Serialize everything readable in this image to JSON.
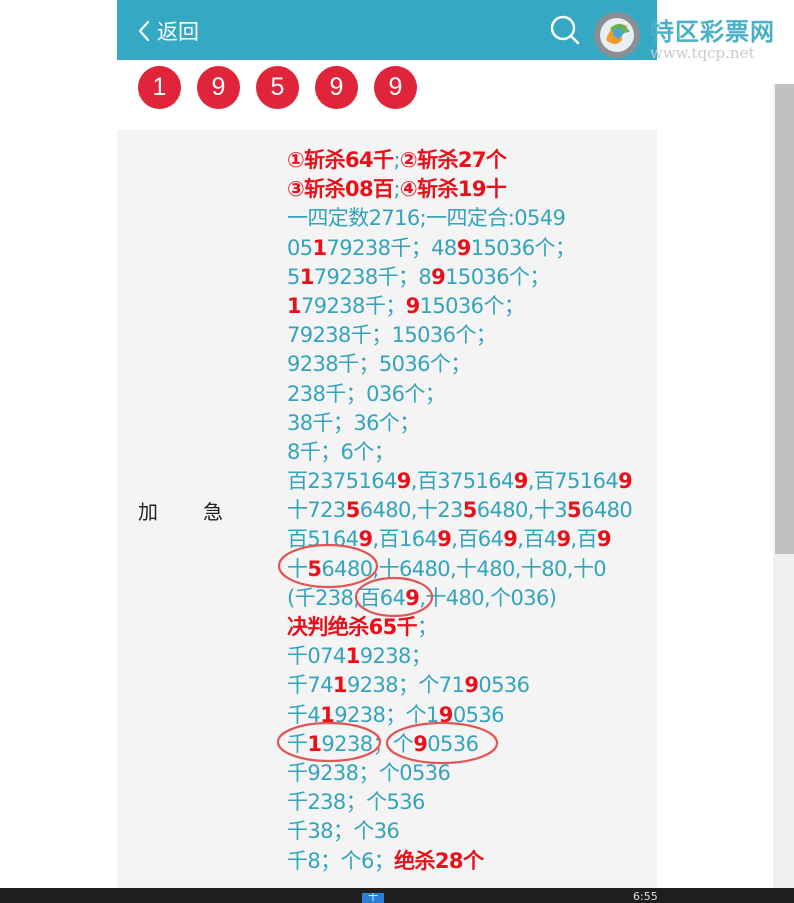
{
  "header": {
    "back_label": "返回",
    "logo_title": "特区彩票网",
    "logo_url": "www.tqcp.net"
  },
  "balls": [
    "1",
    "9",
    "5",
    "9",
    "9"
  ],
  "row_label": {
    "left": "加",
    "right": "急"
  },
  "lines": [
    [
      {
        "t": "①斩杀64千",
        "c": "r"
      },
      {
        "t": ";"
      },
      {
        "t": "②斩杀27个",
        "c": "r"
      }
    ],
    [
      {
        "t": "③斩杀08百",
        "c": "r"
      },
      {
        "t": ";"
      },
      {
        "t": "④斩杀19十",
        "c": "r"
      }
    ],
    [
      {
        "t": "一四定数2716;一四定合:0549"
      }
    ],
    [
      {
        "t": "05"
      },
      {
        "t": "1",
        "c": "b"
      },
      {
        "t": "79238千；48"
      },
      {
        "t": "9",
        "c": "b"
      },
      {
        "t": "15036个；"
      }
    ],
    [
      {
        "t": "5"
      },
      {
        "t": "1",
        "c": "b"
      },
      {
        "t": "79238千；8"
      },
      {
        "t": "9",
        "c": "b"
      },
      {
        "t": "15036个；"
      }
    ],
    [
      {
        "t": "1",
        "c": "b"
      },
      {
        "t": "79238千；"
      },
      {
        "t": "9",
        "c": "b"
      },
      {
        "t": "15036个；"
      }
    ],
    [
      {
        "t": "79238千；15036个；"
      }
    ],
    [
      {
        "t": "9238千；5036个；"
      }
    ],
    [
      {
        "t": "238千；036个；"
      }
    ],
    [
      {
        "t": "38千；36个；"
      }
    ],
    [
      {
        "t": "8千；6个；"
      }
    ],
    [
      {
        "t": "百2375164"
      },
      {
        "t": "9",
        "c": "b"
      },
      {
        "t": ",百375164"
      },
      {
        "t": "9",
        "c": "b"
      },
      {
        "t": ",百75164"
      },
      {
        "t": "9",
        "c": "b"
      }
    ],
    [
      {
        "t": "十723"
      },
      {
        "t": "5",
        "c": "b"
      },
      {
        "t": "6480,十23"
      },
      {
        "t": "5",
        "c": "b"
      },
      {
        "t": "6480,十3"
      },
      {
        "t": "5",
        "c": "b"
      },
      {
        "t": "6480"
      }
    ],
    [
      {
        "t": "百5164"
      },
      {
        "t": "9",
        "c": "b"
      },
      {
        "t": ",百164"
      },
      {
        "t": "9",
        "c": "b"
      },
      {
        "t": ",百64"
      },
      {
        "t": "9",
        "c": "b"
      },
      {
        "t": ",百4"
      },
      {
        "t": "9",
        "c": "b"
      },
      {
        "t": ",百"
      },
      {
        "t": "9",
        "c": "b"
      }
    ],
    [
      {
        "t": "十"
      },
      {
        "t": "5",
        "c": "b"
      },
      {
        "t": "6480,十6480,十480,十80,十0"
      }
    ],
    [
      {
        "t": "(千238,百64"
      },
      {
        "t": "9",
        "c": "b"
      },
      {
        "t": ",十480,个036)"
      }
    ],
    [
      {
        "t": "决判绝杀65千",
        "c": "r"
      },
      {
        "t": "；"
      }
    ],
    [
      {
        "t": "千074"
      },
      {
        "t": "1",
        "c": "b"
      },
      {
        "t": "9238；"
      }
    ],
    [
      {
        "t": "千74"
      },
      {
        "t": "1",
        "c": "b"
      },
      {
        "t": "9238；个71"
      },
      {
        "t": "9",
        "c": "b"
      },
      {
        "t": "0536"
      }
    ],
    [
      {
        "t": "千4"
      },
      {
        "t": "1",
        "c": "b"
      },
      {
        "t": "9238；个1"
      },
      {
        "t": "9",
        "c": "b"
      },
      {
        "t": "0536"
      }
    ],
    [
      {
        "t": "千"
      },
      {
        "t": "1",
        "c": "b"
      },
      {
        "t": "9238；个"
      },
      {
        "t": "9",
        "c": "b"
      },
      {
        "t": "0536"
      }
    ],
    [
      {
        "t": "千9238；个0536"
      }
    ],
    [
      {
        "t": "千238；个536"
      }
    ],
    [
      {
        "t": "千38；个36"
      }
    ],
    [
      {
        "t": "千8；个6；"
      },
      {
        "t": "绝杀28个",
        "c": "r"
      }
    ]
  ],
  "taskbar": {
    "icon_label": "千",
    "time": "6:55"
  },
  "colors": {
    "header_bg": "#35a9c4",
    "ball_red": "#e0243a",
    "text_teal": "#34a3bc",
    "highlight_red": "#e8101a",
    "circle_marker": "#e05555"
  }
}
